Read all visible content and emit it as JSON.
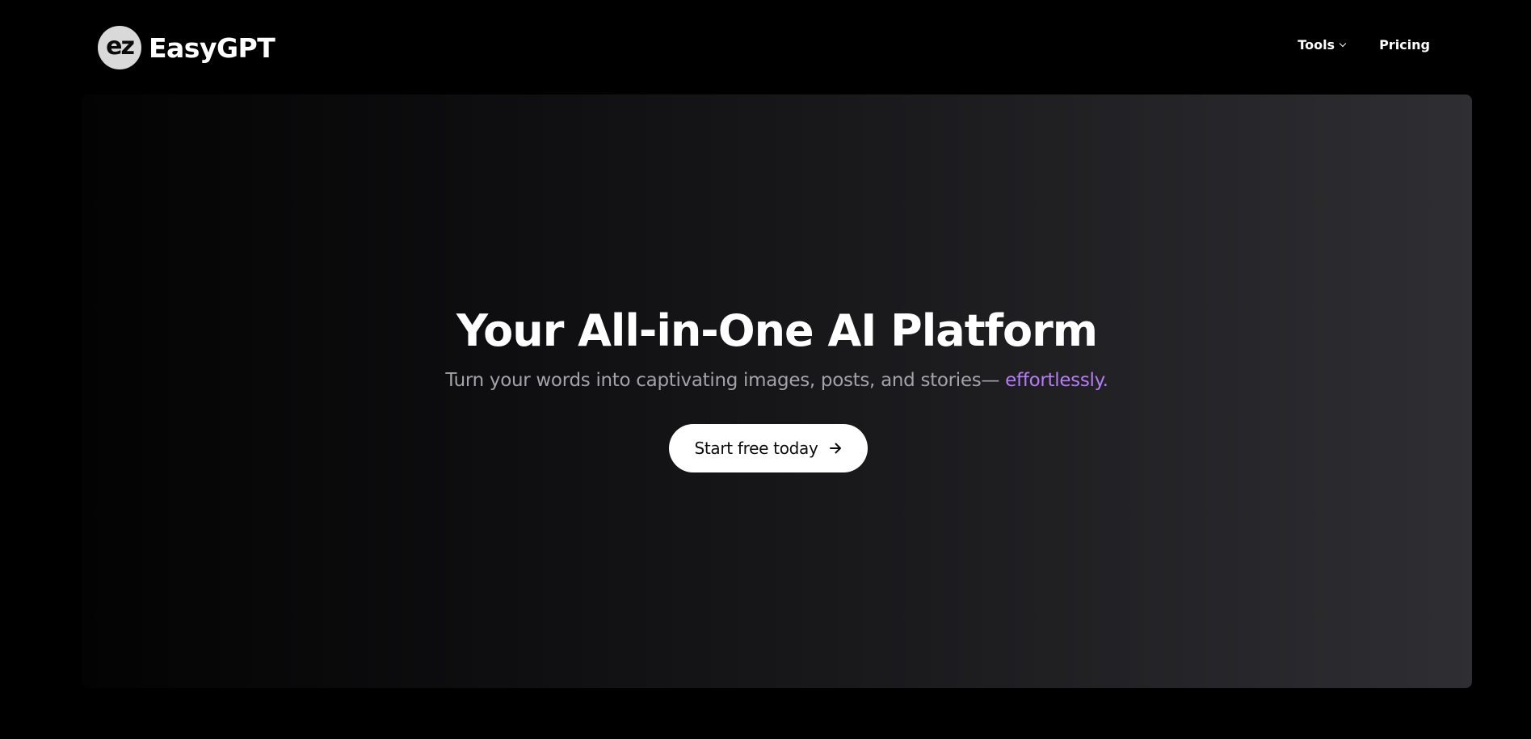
{
  "header": {
    "logo_mark": "ez",
    "brand_name": "EasyGPT",
    "nav": [
      {
        "label": "Tools",
        "has_dropdown": true
      },
      {
        "label": "Pricing",
        "has_dropdown": false
      }
    ]
  },
  "hero": {
    "title": "Your All-in-One AI Platform",
    "subtitle": "Turn your words into captivating images, posts, and stories—",
    "subtitle_accent": "effortlessly.",
    "cta_label": "Start free today",
    "cta_icon": "arrow-right-icon"
  },
  "colors": {
    "background": "#000000",
    "accent": "#b57cf7",
    "cta_background": "#ffffff",
    "subtitle": "#a3a3a8"
  }
}
